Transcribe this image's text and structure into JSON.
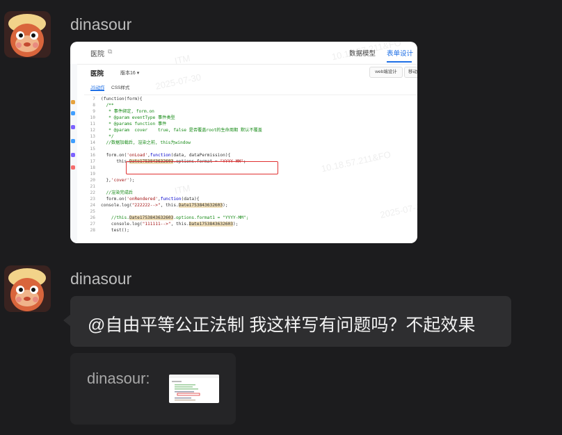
{
  "messages": [
    {
      "sender": "dinasour"
    },
    {
      "sender": "dinasour",
      "text": "@自由平等公正法制 我这样写有问题吗？不起效果",
      "quote": {
        "sender": "dinasour:"
      }
    }
  ],
  "screenshot": {
    "breadcrumb": "医院",
    "tabs": [
      "数据模型",
      "表单设计"
    ],
    "active_tab": "表单设计",
    "form_title": "医院",
    "version": "版本16 ▾",
    "buttons": [
      "web端设计",
      "移动"
    ],
    "subtabs": [
      "JS动作",
      "CSS样式"
    ],
    "watermarks": [
      "10.18.57.211&FO",
      "ITM",
      "2025-07-30"
    ],
    "code": {
      "l7": "(function(form){",
      "l8": "  /**",
      "l9": "   * 事件绑定, form.on",
      "l10": "   * @param eventType 事件类型",
      "l11": "   * @params function 事件",
      "l12": "   * @param  cover    true, false 是否覆盖root的生命周期 默认不覆盖",
      "l13": "   */",
      "l14": "  //数据加载后, 渲染之前, this为window",
      "l16_a": "  form.on(",
      "l16_b": "'onLoad'",
      "l16_c": ",",
      "l16_d": "function",
      "l16_e": "(data, dataPermission){",
      "l17_a": "      this.",
      "l17_b": "Date1753843632603",
      "l17_c": ".options.format = ",
      "l17_d": "\"YYYY-MM\"",
      "l17_e": ";",
      "l20_a": "  },",
      "l20_b": "'cover'",
      "l20_c": ");",
      "l22": "  //渲染完成后",
      "l23_a": "  form.on(",
      "l23_b": "'onRendered'",
      "l23_c": ",",
      "l23_d": "function",
      "l23_e": "(data){",
      "l24_a": "console.log(",
      "l24_b": "\"222222-->\"",
      "l24_c": ", this.",
      "l24_d": "Date1753843632603",
      "l24_e": ");",
      "l26_a": "    //this.",
      "l26_b": "Date1753843632603",
      "l26_c": ".options.format1 = \"YYYY-MM\";",
      "l27_a": "    console.log(",
      "l27_b": "\"111111-->\"",
      "l27_c": ", this.",
      "l27_d": "Date1753843632603",
      "l27_e": ");",
      "l28": "    test();"
    }
  }
}
